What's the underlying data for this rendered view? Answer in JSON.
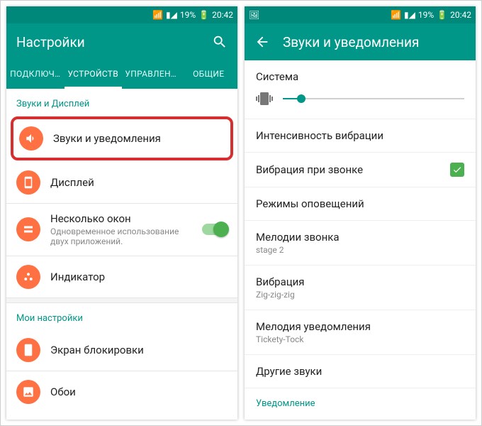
{
  "status": {
    "battery": "19%",
    "time": "20:42"
  },
  "left": {
    "title": "Настройки",
    "tabs": [
      "ПОДКЛЮЧ…",
      "УСТРОЙСТВ",
      "УПРАВЛЕН…",
      "ОБЩИЕ"
    ],
    "section1": "Звуки и Дисплей",
    "items": [
      {
        "label": "Звуки и уведомления"
      },
      {
        "label": "Дисплей"
      },
      {
        "label": "Несколько окон",
        "sub": "Одновременное использование двух приложений."
      },
      {
        "label": "Индикатор"
      }
    ],
    "section2": "Мои настройки",
    "items2": [
      {
        "label": "Экран блокировки"
      },
      {
        "label": "Обои"
      }
    ]
  },
  "right": {
    "title": "Звуки и уведомления",
    "system": "Система",
    "rows": [
      {
        "label": "Интенсивность вибрации"
      },
      {
        "label": "Вибрация при звонке",
        "checked": true
      },
      {
        "label": "Режимы оповещений"
      },
      {
        "label": "Мелодии звонка",
        "sub": "stage 2"
      },
      {
        "label": "Вибрация",
        "sub": "Zig-zig-zig"
      },
      {
        "label": "Мелодия уведомления",
        "sub": "Tickety-Tock"
      },
      {
        "label": "Другие звуки"
      }
    ],
    "section_cut": "Уведомление"
  }
}
